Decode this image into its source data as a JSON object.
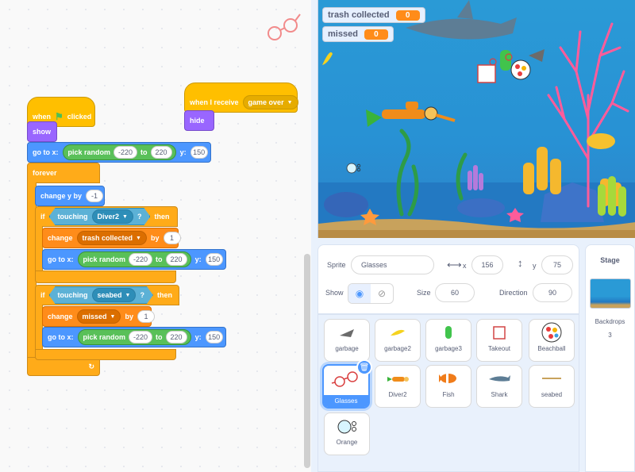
{
  "code": {
    "flag_hat": {
      "when": "when",
      "clicked": "clicked"
    },
    "show": "show",
    "goto1": {
      "label": "go to x:",
      "pick": "pick random",
      "from": "-220",
      "to": "to",
      "to_val": "220",
      "y": "y:",
      "y_val": "150"
    },
    "forever": "forever",
    "change_y": {
      "label": "change y by",
      "val": "-1"
    },
    "if1": {
      "if": "if",
      "touching": "touching",
      "target": "Diver2",
      "q": "?",
      "then": "then"
    },
    "change1": {
      "label": "change",
      "var": "trash collected",
      "by": "by",
      "val": "1"
    },
    "goto2": {
      "label": "go to x:",
      "pick": "pick random",
      "from": "-220",
      "to": "to",
      "to_val": "220",
      "y": "y:",
      "y_val": "150"
    },
    "if2": {
      "if": "if",
      "touching": "touching",
      "target": "seabed",
      "q": "?",
      "then": "then"
    },
    "change2": {
      "label": "change",
      "var": "missed",
      "by": "by",
      "val": "1"
    },
    "goto3": {
      "label": "go to x:",
      "pick": "pick random",
      "from": "-220",
      "to": "to",
      "to_val": "220",
      "y": "y:",
      "y_val": "150"
    },
    "recv_hat": {
      "label": "when I receive",
      "msg": "game over"
    },
    "hide": "hide"
  },
  "stage": {
    "monitors": [
      {
        "label": "trash collected",
        "value": "0"
      },
      {
        "label": "missed",
        "value": "0"
      }
    ]
  },
  "sprite_info": {
    "sprite_label": "Sprite",
    "sprite_name": "Glasses",
    "x_label": "x",
    "x_val": "156",
    "y_label": "y",
    "y_val": "75",
    "show_label": "Show",
    "size_label": "Size",
    "size_val": "60",
    "direction_label": "Direction",
    "direction_val": "90"
  },
  "sprites": [
    {
      "name": "garbage",
      "icon": "garbage-icon"
    },
    {
      "name": "garbage2",
      "icon": "banana-icon"
    },
    {
      "name": "garbage3",
      "icon": "bottle-icon"
    },
    {
      "name": "Takeout",
      "icon": "takeout-icon"
    },
    {
      "name": "Beachball",
      "icon": "beachball-icon"
    },
    {
      "name": "Glasses",
      "icon": "glasses-icon"
    },
    {
      "name": "Diver2",
      "icon": "diver-icon"
    },
    {
      "name": "Fish",
      "icon": "fish-icon"
    },
    {
      "name": "Shark",
      "icon": "shark-icon"
    },
    {
      "name": "seabed",
      "icon": "seabed-icon"
    },
    {
      "name": "Orange",
      "icon": "orange-icon"
    }
  ],
  "stage_panel": {
    "title": "Stage",
    "backdrops_label": "Backdrops",
    "backdrops_count": "3"
  },
  "colors": {
    "events": "#ffbf00",
    "looks": "#9966ff",
    "motion": "#4c97ff",
    "control": "#ffab19",
    "variables": "#ff8c1a",
    "sensing": "#5cb1d6",
    "operators": "#59c059",
    "accent": "#4c97ff"
  }
}
